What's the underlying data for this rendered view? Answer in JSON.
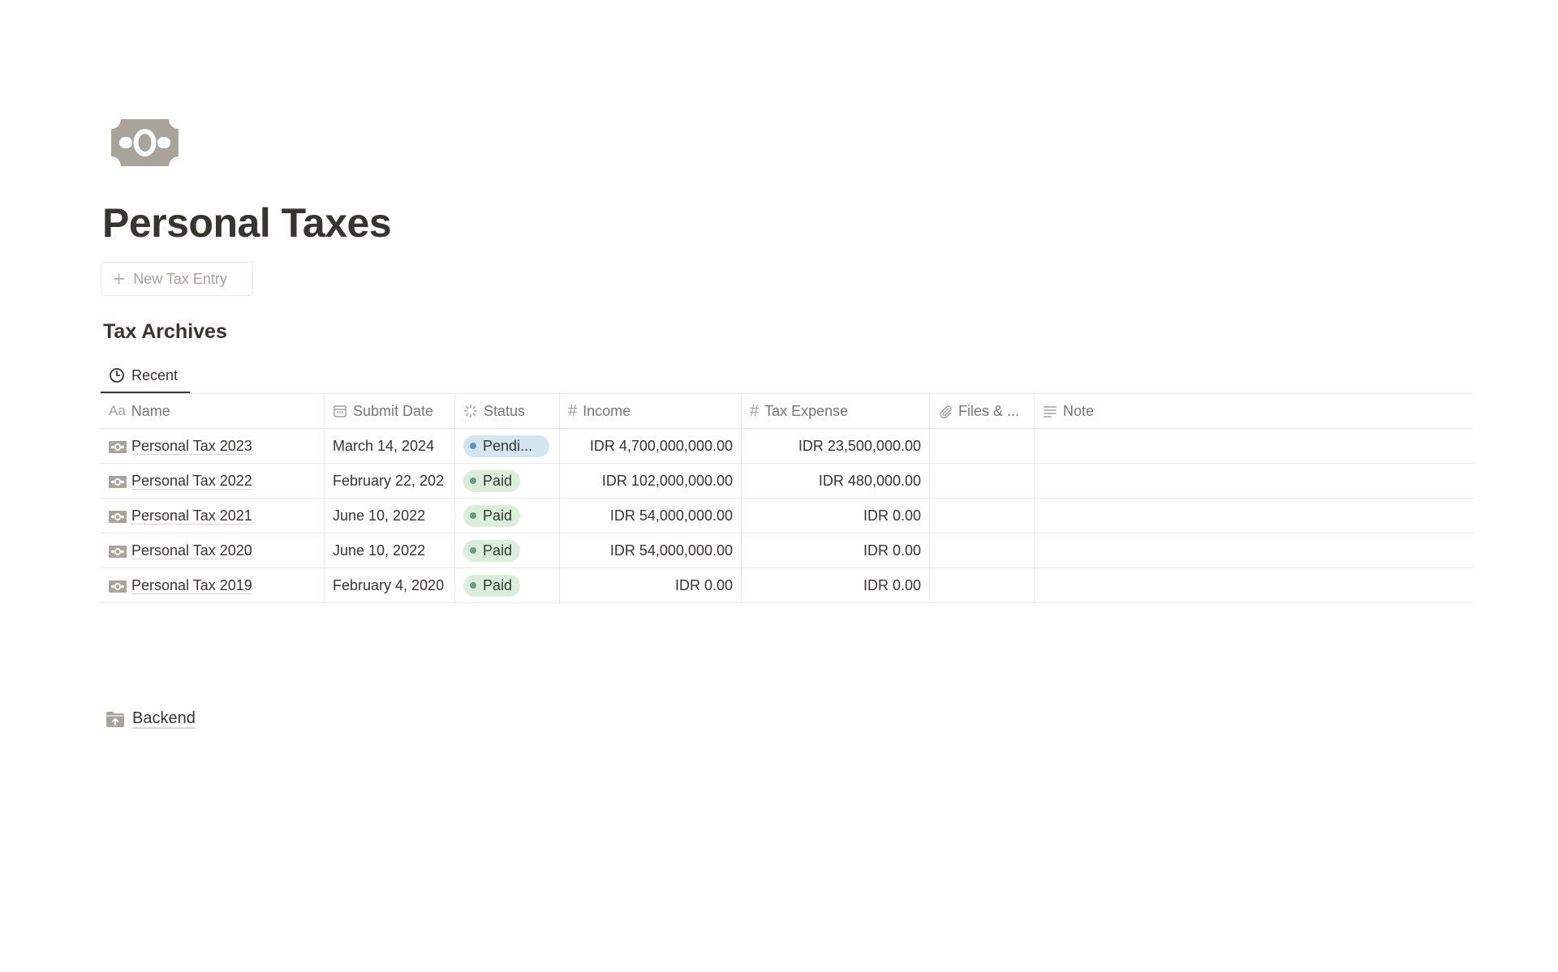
{
  "page": {
    "icon": "money-bill-icon",
    "title": "Personal Taxes"
  },
  "actions": {
    "new_entry_label": "New Tax Entry"
  },
  "database": {
    "title": "Tax Archives",
    "view_tab": {
      "icon": "clock-icon",
      "label": "Recent"
    },
    "columns": {
      "name": "Name",
      "submit_date": "Submit Date",
      "status": "Status",
      "income": "Income",
      "tax_expense": "Tax Expense",
      "files": "Files & ...",
      "note": "Note"
    },
    "rows": [
      {
        "name": "Personal Tax 2023",
        "submit_date": "March 14, 2024",
        "status": "Pendi...",
        "status_kind": "pending",
        "income": "IDR 4,700,000,000.00",
        "tax_expense": "IDR 23,500,000.00",
        "files": "",
        "note": ""
      },
      {
        "name": "Personal Tax 2022",
        "submit_date": "February 22, 202",
        "status": "Paid",
        "status_kind": "paid",
        "income": "IDR 102,000,000.00",
        "tax_expense": "IDR 480,000.00",
        "files": "",
        "note": ""
      },
      {
        "name": "Personal Tax 2021",
        "submit_date": "June 10, 2022",
        "status": "Paid",
        "status_kind": "paid",
        "income": "IDR 54,000,000.00",
        "tax_expense": "IDR 0.00",
        "files": "",
        "note": ""
      },
      {
        "name": "Personal Tax 2020",
        "submit_date": "June 10, 2022",
        "status": "Paid",
        "status_kind": "paid",
        "income": "IDR 54,000,000.00",
        "tax_expense": "IDR 0.00",
        "files": "",
        "note": ""
      },
      {
        "name": "Personal Tax 2019",
        "submit_date": "February 4, 2020",
        "status": "Paid",
        "status_kind": "paid",
        "income": "IDR 0.00",
        "tax_expense": "IDR 0.00",
        "files": "",
        "note": ""
      }
    ]
  },
  "backend_link": {
    "icon": "folder-upload-icon",
    "label": "Backend"
  },
  "colors": {
    "text": "#37352f",
    "muted": "#787774",
    "border": "#e9e9e7",
    "paid_bg": "#dbeddb",
    "pending_bg": "#d3e5ef",
    "icon_gray": "#a8a49c"
  }
}
